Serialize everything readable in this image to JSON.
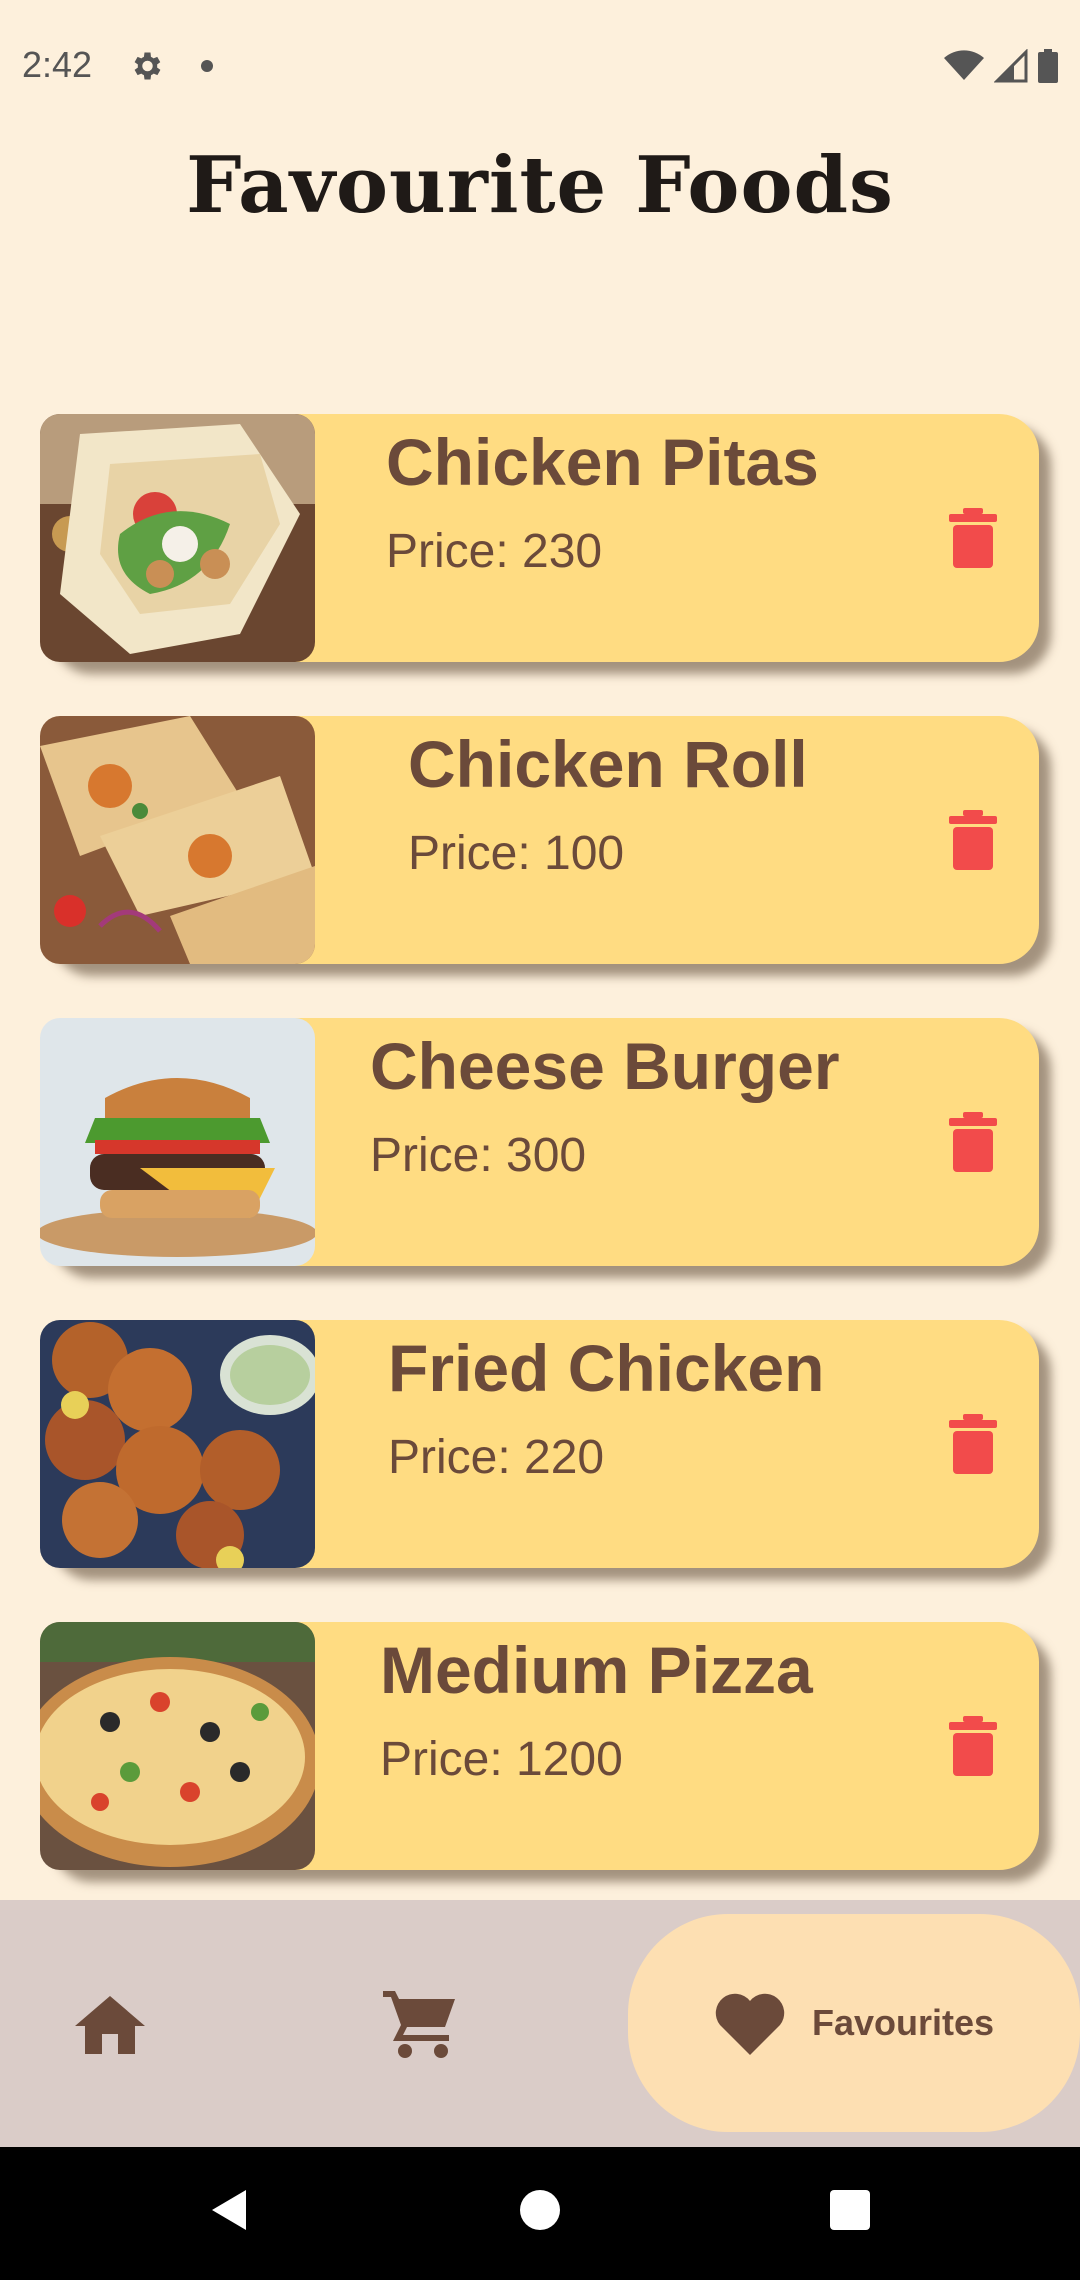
{
  "status": {
    "time": "2:42"
  },
  "title": "Favourite Foods",
  "foods": [
    {
      "name": "Chicken Pitas",
      "price": "Price: 230"
    },
    {
      "name": "Chicken Roll",
      "price": "Price: 100"
    },
    {
      "name": "Cheese Burger",
      "price": "Price: 300"
    },
    {
      "name": "Fried Chicken",
      "price": "Price: 220"
    },
    {
      "name": "Medium Pizza",
      "price": "Price: 1200"
    }
  ],
  "nav": {
    "items": [
      {
        "icon": "home-icon"
      },
      {
        "icon": "cart-icon"
      },
      {
        "icon": "heart-icon",
        "label": "Favourites"
      }
    ]
  },
  "colors": {
    "background": "#FDF0DC",
    "card": "#FFDC82",
    "text_brown": "#6b4a3a",
    "delete_red": "#F24B4B",
    "nav_bar": "#DACCC8",
    "nav_selected": "#FDDFB2"
  }
}
